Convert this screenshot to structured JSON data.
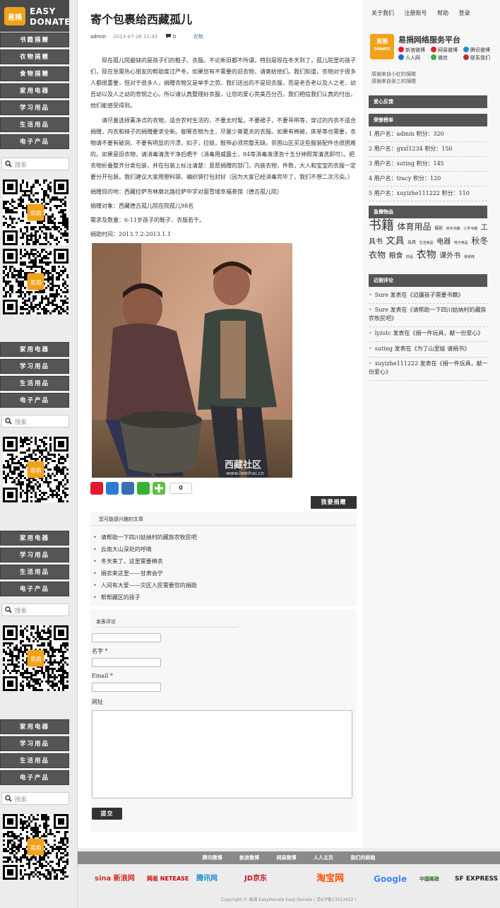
{
  "brand": {
    "logo_mark": "易捐",
    "name_line1": "EASY",
    "name_line2": "DONATE"
  },
  "left_sidebar": {
    "categories_top": [
      "书籍捐赠",
      "衣物捐赠",
      "食物捐赠",
      "家用电器",
      "学习用品",
      "生活用品",
      "电子产品"
    ],
    "categories_repeat": [
      "家用电器",
      "学习用品",
      "生活用品",
      "电子产品"
    ],
    "search_placeholder": "搜索",
    "qr_badge": "易捐"
  },
  "post": {
    "title": "寄个包裹给西藏孤儿",
    "author": "admin",
    "date": "2013-07-26 11:43",
    "comment_count": "0",
    "category": "衣物",
    "paragraphs": [
      "现在孤儿院最缺的是孩子们的鞋子、衣服。不论新旧都不所谓，特别是现在冬天到了，孤儿院里的孩子们，现在急需热心朋友的帮助度过严冬。如果您有不需要的旧衣物，请寄给他们。我们知道，衣物对于很多人都很重要，但对于很多人，捐赠衣物又是举手之劳。我们送出的不是旧衣服，而是老吾老以及人之老，幼吾幼以及人之幼的悲悯之心。所以请认真整理好衣服，让您的爱心完美百分百，我们相信我们认真的付出，他们能感受得到。",
      "请尽量选择素净点的衣物，适合农村生活的，不要太时髦，不要裙子，不要吊带等，穿过的内衣不适合捐赠，内衣和袜子的捐赠要求全新。御寒衣物为主，尽量少寄夏天的衣服。如果有棉被，床单等也需要，衣物请不要有破洞，不要有明显的污渍，扣子，拉链，鞋带必须完整无缺。贫困山区买这些服装配件也很困难的。如果是旧衣物，请消毒清洗干净后晒干（消毒用威露士，84等消毒液浸泡十五分钟照常清洗即可）。把衣物折叠整齐分类包装，并在包装上标注清楚：意愿捐赠的部门，内装衣物，件数，大人和宝宝的衣服一定要分开包装。我们建议大家用塑料袋、编织袋打包封好（因为大家已经消毒完毕了，我们不想二次污染。）"
    ],
    "info": [
      "捐赠目的地：西藏拉萨市林廓北路拉萨中学对面雪域幸福茶馆（德吉孤儿院）",
      "捐赠对象：西藏德吉孤儿院在院孤儿98名",
      "需求及数量：6-11岁孩子的鞋子、衣服若干。",
      "捐助时间：2013.7.2-2013.1.1"
    ],
    "photo_watermark": "西藏社区",
    "photo_watermark_url": "www.lweihai.cn",
    "share_count": "0",
    "donate_button": "我要捐赠"
  },
  "related": {
    "heading": "您可能感兴趣的文章",
    "items": [
      "请帮助一下四川姑纳村的藏族农牧民吧",
      "云南大山深处的呼唤",
      "冬天来了，这里需要棉衣",
      "捐衣来这里——甘肃会宁",
      "人间有大爱——灾区人民需要您的捐助",
      "帮帮藏区的孩子"
    ]
  },
  "comment_form": {
    "heading": "发表评论",
    "name_label": "名字",
    "email_label": "Email",
    "required_mark": "*",
    "url_label": "网址",
    "submit": "提交"
  },
  "right_sidebar": {
    "top_nav": [
      "关于我们",
      "注册账号",
      "帮助",
      "登录"
    ],
    "platform": {
      "title": "易捐网络服务平台",
      "links": [
        "新浪微博",
        "网易微博",
        "腾讯微博",
        "人人网",
        "微信",
        "联系我们"
      ],
      "link_colors": [
        "#e6162d",
        "#d22",
        "#1d8fd1",
        "#1d6fcf",
        "#3cb034",
        "#c03030"
      ]
    },
    "ticker": [
      "感谢来自小红的捐赠",
      "感谢来自张三的捐赠"
    ],
    "feedback_heading": "爱心反馈",
    "rank_heading": "荣誉榜单",
    "ranks": [
      "1 用户名：admin 积分：320",
      "2 用户名：gxxl1234 积分：150",
      "3 用户名：suting 积分：145",
      "4 用户名：tracy 积分：120",
      "5 用户名：xuyizhe111222 积分：110"
    ],
    "urgent_heading": "急需物品",
    "tags": [
      {
        "t": "书籍",
        "s": 18
      },
      {
        "t": "体育用品",
        "s": 12
      },
      {
        "t": "摄影",
        "s": 6
      },
      {
        "t": "初中书籍",
        "s": 5
      },
      {
        "t": "小学书籍",
        "s": 5
      },
      {
        "t": "工具书",
        "s": 10
      },
      {
        "t": "文具",
        "s": 13
      },
      {
        "t": "玩具",
        "s": 6
      },
      {
        "t": "生活用品",
        "s": 5
      },
      {
        "t": "电器",
        "s": 10
      },
      {
        "t": "电子用品",
        "s": 5
      },
      {
        "t": "秋冬衣物",
        "s": 12
      },
      {
        "t": "粮食",
        "s": 10
      },
      {
        "t": "药品",
        "s": 5
      },
      {
        "t": "衣物",
        "s": 14
      },
      {
        "t": "课外书",
        "s": 10
      },
      {
        "t": "课桌椅",
        "s": 5
      }
    ],
    "recent_heading": "近期评论",
    "recent_comments": [
      "Sure 发表在《边疆孩子需要书籍》",
      "Sure 发表在《请帮助一下四川姑纳村的藏族农牧民吧》",
      "lyzstc 发表在《捐一件玩具，献一份爱心》",
      "suting 发表在《为了山里娃 请捐书》",
      "xuyizhe111222 发表在《捐一件玩具，献一份爱心》"
    ]
  },
  "footer": {
    "nav": [
      "腾讯微博",
      "新浪微博",
      "网易微博",
      "人人主页",
      "我们的邮箱"
    ],
    "partners": [
      {
        "name": "sina 新浪网",
        "color": "#d52b1e"
      },
      {
        "name": "网易 NETEASE",
        "color": "#c00"
      },
      {
        "name": "腾讯网",
        "color": "#1d8fd1"
      },
      {
        "name": "JD京东",
        "color": "#c81623"
      },
      {
        "name": "淘宝网",
        "color": "#ff5000"
      },
      {
        "name": "Google",
        "color": "#4285f4"
      },
      {
        "name": "中国邮政",
        "color": "#2a6a2a"
      },
      {
        "name": "SF EXPRESS",
        "color": "#222"
      }
    ],
    "copyright": "Copyright © 易捐 EasyDonate Easy-Donate ( 京ICP备13013432 )"
  }
}
